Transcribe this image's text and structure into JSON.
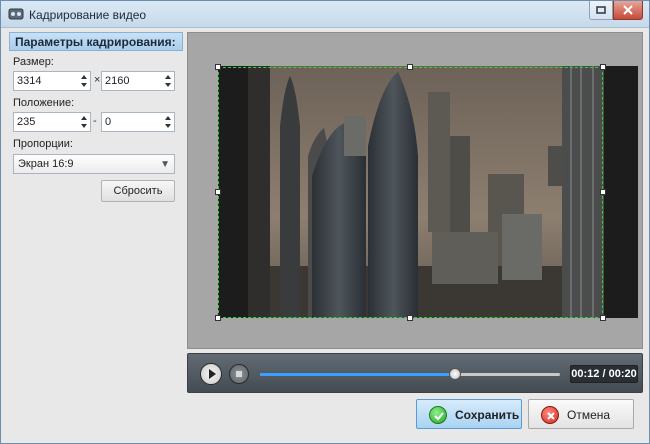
{
  "window": {
    "title": "Кадрирование видео"
  },
  "panel": {
    "header": "Параметры кадрирования:",
    "size_label": "Размер:",
    "width": "3314",
    "size_sep": "×",
    "height": "2160",
    "position_label": "Положение:",
    "pos_x": "235",
    "pos_sep": "-",
    "pos_y": "0",
    "aspect_label": "Пропорции:",
    "aspect_value": "Экран 16:9",
    "reset_label": "Сбросить"
  },
  "player": {
    "time": "00:12 / 00:20",
    "progress": 0.65
  },
  "footer": {
    "save_label": "Сохранить",
    "cancel_label": "Отмена"
  },
  "colors": {
    "crop_border": "#2fd12f",
    "accent": "#3aa0ff"
  },
  "icons": {
    "app": "film-icon",
    "restore": "restore-icon",
    "close": "close-icon",
    "play": "play-icon",
    "stop": "stop-icon",
    "save": "check-icon",
    "cancel": "cancel-icon"
  }
}
